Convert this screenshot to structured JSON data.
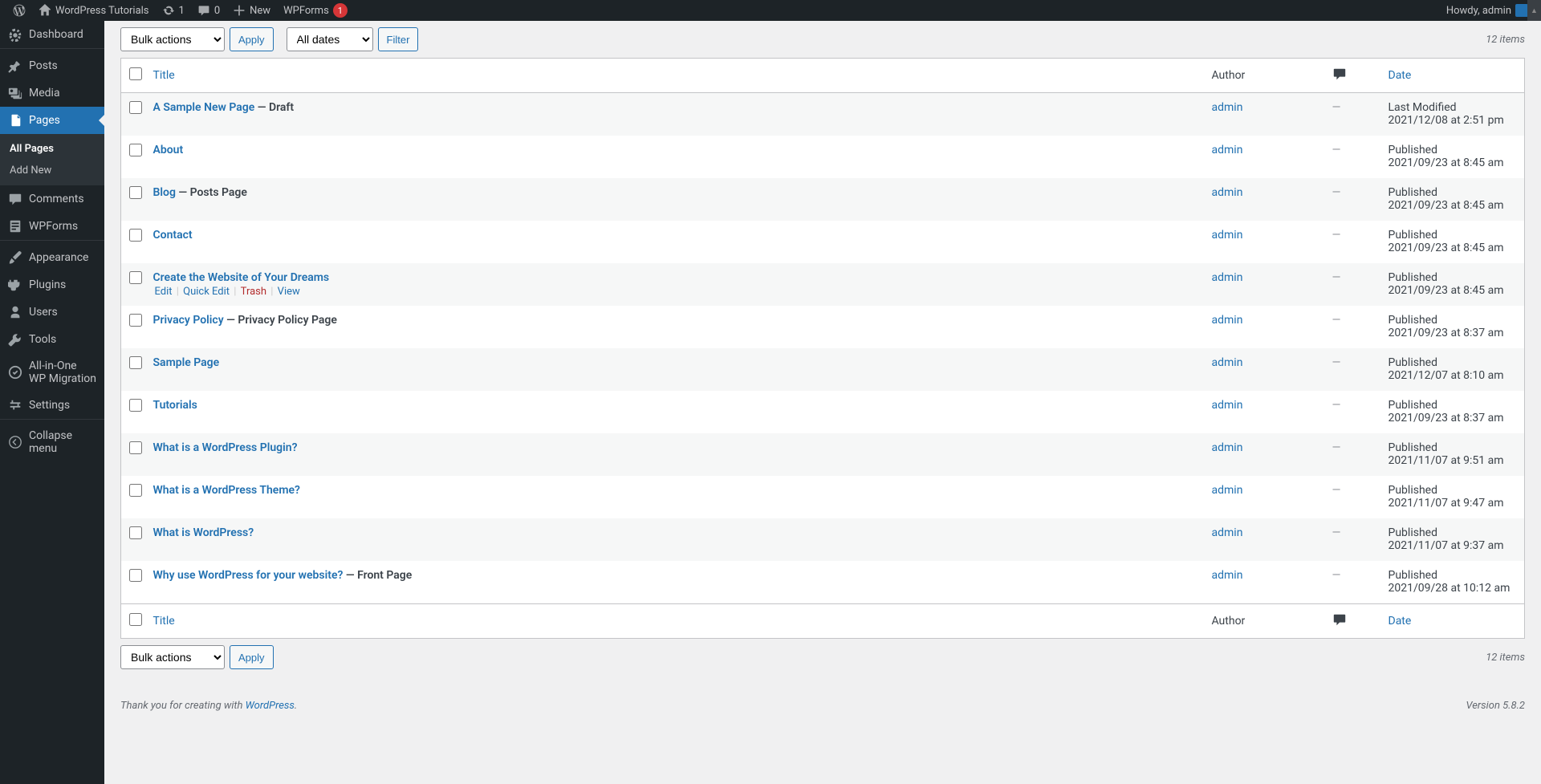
{
  "adminbar": {
    "site_title": "WordPress Tutorials",
    "updates": "1",
    "comments": "0",
    "new_label": "New",
    "wpforms_label": "WPForms",
    "wpforms_badge": "1",
    "howdy": "Howdy, admin"
  },
  "sidebar": {
    "dashboard": "Dashboard",
    "posts": "Posts",
    "media": "Media",
    "pages": "Pages",
    "all_pages": "All Pages",
    "add_new": "Add New",
    "comments": "Comments",
    "wpforms": "WPForms",
    "appearance": "Appearance",
    "plugins": "Plugins",
    "users": "Users",
    "tools": "Tools",
    "migration": "All-in-One WP Migration",
    "settings": "Settings",
    "collapse": "Collapse menu"
  },
  "filters": {
    "bulk": "Bulk actions",
    "apply": "Apply",
    "all_dates": "All dates",
    "filter": "Filter",
    "items_count": "12 items"
  },
  "table": {
    "title_label": "Title",
    "author_label": "Author",
    "date_label": "Date",
    "rows": [
      {
        "title": "A Sample New Page",
        "state": " — Draft",
        "author": "admin",
        "comments": "—",
        "status": "Last Modified",
        "date": "2021/12/08 at 2:51 pm"
      },
      {
        "title": "About",
        "state": "",
        "author": "admin",
        "comments": "—",
        "status": "Published",
        "date": "2021/09/23 at 8:45 am"
      },
      {
        "title": "Blog",
        "state": " — Posts Page",
        "author": "admin",
        "comments": "—",
        "status": "Published",
        "date": "2021/09/23 at 8:45 am"
      },
      {
        "title": "Contact",
        "state": "",
        "author": "admin",
        "comments": "—",
        "status": "Published",
        "date": "2021/09/23 at 8:45 am"
      },
      {
        "title": "Create the Website of Your Dreams",
        "state": "",
        "author": "admin",
        "comments": "—",
        "status": "Published",
        "date": "2021/09/23 at 8:45 am",
        "show_actions": true
      },
      {
        "title": "Privacy Policy",
        "state": " — Privacy Policy Page",
        "author": "admin",
        "comments": "—",
        "status": "Published",
        "date": "2021/09/23 at 8:37 am"
      },
      {
        "title": "Sample Page",
        "state": "",
        "author": "admin",
        "comments": "—",
        "status": "Published",
        "date": "2021/12/07 at 8:10 am"
      },
      {
        "title": "Tutorials",
        "state": "",
        "author": "admin",
        "comments": "—",
        "status": "Published",
        "date": "2021/09/23 at 8:37 am"
      },
      {
        "title": "What is a WordPress Plugin?",
        "state": "",
        "author": "admin",
        "comments": "—",
        "status": "Published",
        "date": "2021/11/07 at 9:51 am"
      },
      {
        "title": "What is a WordPress Theme?",
        "state": "",
        "author": "admin",
        "comments": "—",
        "status": "Published",
        "date": "2021/11/07 at 9:47 am"
      },
      {
        "title": "What is WordPress?",
        "state": "",
        "author": "admin",
        "comments": "—",
        "status": "Published",
        "date": "2021/11/07 at 9:37 am"
      },
      {
        "title": "Why use WordPress for your website?",
        "state": " — Front Page",
        "author": "admin",
        "comments": "—",
        "status": "Published",
        "date": "2021/09/28 at 10:12 am"
      }
    ]
  },
  "row_actions": {
    "edit": "Edit",
    "quick": "Quick Edit",
    "trash": "Trash",
    "view": "View"
  },
  "footer": {
    "thank": "Thank you for creating with ",
    "wp": "WordPress",
    "dot": ".",
    "version": "Version 5.8.2"
  }
}
